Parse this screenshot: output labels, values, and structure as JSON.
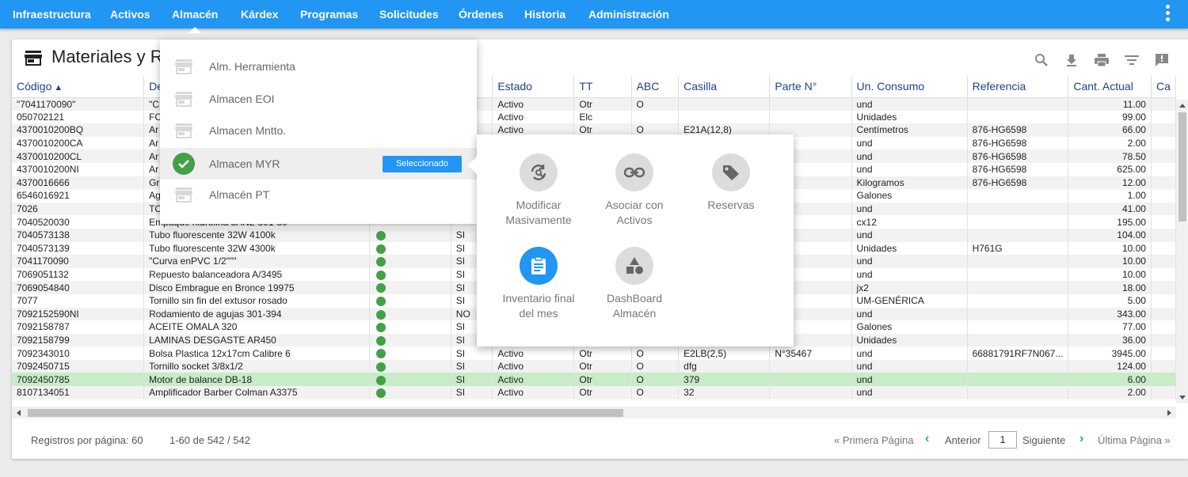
{
  "nav": [
    "Infraestructura",
    "Activos",
    "Almacén",
    "Kárdex",
    "Programas",
    "Solicitudes",
    "Órdenes",
    "Historia",
    "Administración"
  ],
  "page_title": "Materiales y R",
  "columns": [
    "Código",
    "De",
    "",
    "",
    "Estado",
    "TT",
    "ABC",
    "Casilla",
    "Parte N°",
    "Un. Consumo",
    "Referencia",
    "Cant. Actual",
    "Ca"
  ],
  "rows": [
    {
      "codigo": "\"7041170090\"",
      "desc": "\"C",
      "dot": false,
      "si": "",
      "estado": "Activo",
      "tt": "Otr",
      "abc": "O",
      "casilla": "",
      "parte": "",
      "un": "und",
      "ref": "",
      "cant": "11.00"
    },
    {
      "codigo": "050702121",
      "desc": "FC",
      "dot": false,
      "si": "",
      "estado": "Activo",
      "tt": "Elc",
      "abc": "",
      "casilla": "",
      "parte": "",
      "un": "Unidades",
      "ref": "",
      "cant": "99.00"
    },
    {
      "codigo": "4370010200BQ",
      "desc": "Ar",
      "dot": false,
      "si": "",
      "estado": "Activo",
      "tt": "Otr",
      "abc": "O",
      "casilla": "E21A(12,8)",
      "parte": "",
      "un": "Centímetros",
      "ref": "876-HG6598",
      "cant": "66.00"
    },
    {
      "codigo": "4370010200CA",
      "desc": "Ar",
      "dot": false,
      "si": "",
      "estado": "",
      "tt": "",
      "abc": "",
      "casilla": "",
      "parte": "",
      "un": "und",
      "ref": "876-HG6598",
      "cant": "2.00"
    },
    {
      "codigo": "4370010200CL",
      "desc": "Ar",
      "dot": false,
      "si": "",
      "estado": "",
      "tt": "",
      "abc": "",
      "casilla": "",
      "parte": "",
      "un": "und",
      "ref": "876-HG6598",
      "cant": "78.50"
    },
    {
      "codigo": "4370010200NI",
      "desc": "Ar",
      "dot": false,
      "si": "",
      "estado": "",
      "tt": "",
      "abc": "",
      "casilla": "",
      "parte": "",
      "un": "und",
      "ref": "876-HG6598",
      "cant": "625.00"
    },
    {
      "codigo": "4370016666",
      "desc": "Gr",
      "dot": false,
      "si": "",
      "estado": "",
      "tt": "",
      "abc": "",
      "casilla": "",
      "parte": "",
      "un": "Kilogramos",
      "ref": "876-HG6598",
      "cant": "12.00"
    },
    {
      "codigo": "6546016921",
      "desc": "Ag",
      "dot": false,
      "si": "",
      "estado": "",
      "tt": "",
      "abc": "",
      "casilla": "",
      "parte": "",
      "un": "Galones",
      "ref": "",
      "cant": "1.00"
    },
    {
      "codigo": "7026",
      "desc": "TC",
      "dot": false,
      "si": "",
      "estado": "",
      "tt": "",
      "abc": "",
      "casilla": "",
      "parte": "",
      "un": "und",
      "ref": "",
      "cant": "41.00"
    },
    {
      "codigo": "7040520030",
      "desc": "Empaque hidrolina 3AN2-301-30",
      "dot": false,
      "si": "",
      "estado": "",
      "tt": "",
      "abc": "",
      "casilla": "",
      "parte": "",
      "un": "cx12",
      "ref": "",
      "cant": "195.00"
    },
    {
      "codigo": "7040573138",
      "desc": "Tubo fluorescente 32W 4100k",
      "dot": true,
      "si": "SI",
      "estado": "",
      "tt": "",
      "abc": "",
      "casilla": "",
      "parte": "",
      "un": "und",
      "ref": "",
      "cant": "104.00"
    },
    {
      "codigo": "7040573139",
      "desc": "Tubo fluorescente 32W 4300k",
      "dot": true,
      "si": "SI",
      "estado": "",
      "tt": "",
      "abc": "",
      "casilla": "",
      "parte": "",
      "un": "Unidades",
      "ref": "H761G",
      "cant": "10.00"
    },
    {
      "codigo": "7041170090",
      "desc": "\"Curva enPVC 1/2\"\"\"",
      "dot": true,
      "si": "SI",
      "estado": "",
      "tt": "",
      "abc": "",
      "casilla": "",
      "parte": "",
      "un": "und",
      "ref": "",
      "cant": "10.00"
    },
    {
      "codigo": "7069051132",
      "desc": "Repuesto balanceadora A/3495",
      "dot": true,
      "si": "SI",
      "estado": "",
      "tt": "",
      "abc": "",
      "casilla": "",
      "parte": "",
      "un": "und",
      "ref": "",
      "cant": "10.00"
    },
    {
      "codigo": "7069054840",
      "desc": "Disco Embrague en Bronce 19975",
      "dot": true,
      "si": "SI",
      "estado": "",
      "tt": "",
      "abc": "",
      "casilla": "",
      "parte": "",
      "un": "jx2",
      "ref": "",
      "cant": "18.00"
    },
    {
      "codigo": "7077",
      "desc": "Tornillo sin fin del extusor rosado",
      "dot": true,
      "si": "SI",
      "estado": "",
      "tt": "",
      "abc": "",
      "casilla": "",
      "parte": "",
      "un": "UM-GENÉRICA",
      "ref": "",
      "cant": "5.00"
    },
    {
      "codigo": "7092152590NI",
      "desc": "Rodamiento de agujas 301-394",
      "dot": true,
      "si": "NO",
      "estado": "",
      "tt": "",
      "abc": "",
      "casilla": "",
      "parte": "",
      "un": "und",
      "ref": "",
      "cant": "343.00"
    },
    {
      "codigo": "7092158787",
      "desc": "ACEITE OMALA 320",
      "dot": true,
      "si": "SI",
      "estado": "",
      "tt": "",
      "abc": "",
      "casilla": "",
      "parte": "",
      "un": "Galones",
      "ref": "",
      "cant": "77.00"
    },
    {
      "codigo": "7092158799",
      "desc": "LAMINAS DESGASTE AR450",
      "dot": true,
      "si": "SI",
      "estado": "",
      "tt": "",
      "abc": "",
      "casilla": "",
      "parte": "",
      "un": "Unidades",
      "ref": "",
      "cant": "36.00"
    },
    {
      "codigo": "7092343010",
      "desc": "Bolsa Plastica 12x17cm Calibre 6",
      "dot": true,
      "si": "SI",
      "estado": "Activo",
      "tt": "Otr",
      "abc": "O",
      "casilla": "E2LB(2,5)",
      "parte": "N°35467",
      "un": "und",
      "ref": "66881791RF7N067...",
      "cant": "3945.00"
    },
    {
      "codigo": "7092450715",
      "desc": "Tornillo socket 3/8x1/2",
      "dot": true,
      "si": "SI",
      "estado": "Activo",
      "tt": "Otr",
      "abc": "O",
      "casilla": "dfg",
      "parte": "",
      "un": "und",
      "ref": "",
      "cant": "124.00"
    },
    {
      "codigo": "7092450785",
      "desc": "Motor de balance DB-18",
      "dot": true,
      "si": "SI",
      "estado": "Activo",
      "tt": "Otr",
      "abc": "O",
      "casilla": "379",
      "parte": "",
      "un": "und",
      "ref": "",
      "cant": "6.00"
    },
    {
      "codigo": "8107134051",
      "desc": "Amplificador Barber Colman A3375",
      "dot": true,
      "si": "SI",
      "estado": "Activo",
      "tt": "Otr",
      "abc": "O",
      "casilla": "32",
      "parte": "",
      "un": "und",
      "ref": "",
      "cant": "2.00"
    }
  ],
  "selected_row": 21,
  "footer": {
    "per_page": "Registros por página: 60",
    "range": "1-60 de 542 / 542",
    "first": "« Primera Página",
    "prev": "Anterior",
    "page": "1",
    "next": "Siguiente",
    "last": "Última Página »"
  },
  "dropdown": {
    "items": [
      "Alm. Herramienta",
      "Almacen EOI",
      "Almacen Mntto.",
      "Almacen MYR",
      "Almacén PT"
    ],
    "selected_index": 3,
    "badge": "Seleccionado"
  },
  "actions": [
    {
      "label": "Modificar\nMasivamente",
      "icon": "refresh-search-icon"
    },
    {
      "label": "Asociar con\nActivos",
      "icon": "link-icon"
    },
    {
      "label": "Reservas",
      "icon": "tag-icon"
    },
    {
      "label": "Inventario final\ndel mes",
      "icon": "clipboard-icon"
    },
    {
      "label": "DashBoard\nAlmacén",
      "icon": "shapes-icon"
    }
  ],
  "colors": {
    "nav": "#2196f3",
    "accent": "#2196f3",
    "check": "#43a047",
    "selected_row": "#c8ebc8"
  }
}
